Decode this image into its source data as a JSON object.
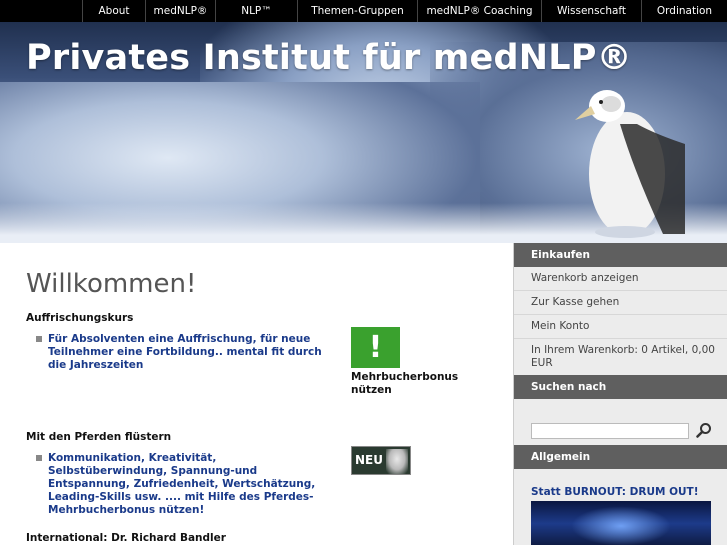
{
  "nav": {
    "items": [
      {
        "label": "About"
      },
      {
        "label": "medNLP®"
      },
      {
        "label": "NLP™"
      },
      {
        "label": "Themen-Gruppen"
      },
      {
        "label": "medNLP® Coaching"
      },
      {
        "label": "Wissenschaft"
      },
      {
        "label": "Ordination"
      }
    ]
  },
  "header": {
    "title": "Privates Institut für medNLP®"
  },
  "main": {
    "heading": "Willkommen!",
    "sections": [
      {
        "title": "Auffrischungskurs",
        "item": "Für Absolventen eine Auffrischung, für neue Teilnehmer eine Fortbildung.. mental fit durch die Jahreszeiten"
      },
      {
        "title": "Mit den Pferden flüstern",
        "item": "Kommunikation, Kreativität, Selbstüberwindung, Spannung-und Entspannung, Zufriedenheit, Wertschätzung, Leading-Skills usw. .... mit Hilfe des Pferdes- Mehrbucherbonus nützen!"
      },
      {
        "title": "International: Dr. Richard Bandler"
      }
    ],
    "promo": {
      "symbol": "!",
      "caption": "Mehrbucherbonus nützen"
    },
    "badge": {
      "label": "NEU"
    }
  },
  "sidebar": {
    "shop_heading": "Einkaufen",
    "links": [
      "Warenkorb anzeigen",
      "Zur Kasse gehen",
      "Mein Konto"
    ],
    "cart_info": "In Ihrem Warenkorb: 0 Artikel, 0,00 EUR",
    "search_heading": "Suchen nach",
    "search_value": "",
    "general_heading": "Allgemein",
    "feature_title": "Statt BURNOUT: DRUM OUT!"
  },
  "icons": {
    "search": "magnifier-icon"
  },
  "colors": {
    "accent": "#1a3a8a",
    "sidebar_header": "#5f5f5f",
    "promo_green": "#3aa12e",
    "nav_bg": "#000000"
  }
}
